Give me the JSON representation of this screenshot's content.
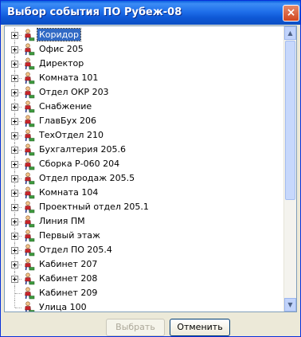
{
  "window": {
    "title": "Выбор события ПО Рубеж-08",
    "close_glyph": "×"
  },
  "tree": {
    "items": [
      {
        "label": "Коридор",
        "selected": true,
        "expandable": true
      },
      {
        "label": "Офис 205",
        "expandable": true
      },
      {
        "label": "Директор",
        "expandable": true
      },
      {
        "label": "Комната 101",
        "expandable": true
      },
      {
        "label": "Отдел ОКР 203",
        "expandable": true
      },
      {
        "label": "Снабжение",
        "expandable": true
      },
      {
        "label": "ГлавБух 206",
        "expandable": true
      },
      {
        "label": "ТехОтдел 210",
        "expandable": true
      },
      {
        "label": "Бухгалтерия 205.6",
        "expandable": true
      },
      {
        "label": "Сборка Р-060 204",
        "expandable": true
      },
      {
        "label": "Отдел продаж 205.5",
        "expandable": true
      },
      {
        "label": "Комната 104",
        "expandable": true
      },
      {
        "label": "Проектный отдел 205.1",
        "expandable": true
      },
      {
        "label": "Линия ПМ",
        "expandable": true
      },
      {
        "label": "Первый этаж",
        "expandable": true
      },
      {
        "label": "Отдел ПО 205.4",
        "expandable": true
      },
      {
        "label": "Кабинет 207",
        "expandable": true
      },
      {
        "label": "Кабинет 208",
        "expandable": true
      },
      {
        "label": "Кабинет 209",
        "expandable": false
      },
      {
        "label": "Улица 100",
        "expandable": false
      }
    ]
  },
  "buttons": {
    "select_label": "Выбрать",
    "cancel_label": "Отменить"
  },
  "colors": {
    "selection": "#316ac5",
    "titlebar": "#0b4fc4"
  }
}
